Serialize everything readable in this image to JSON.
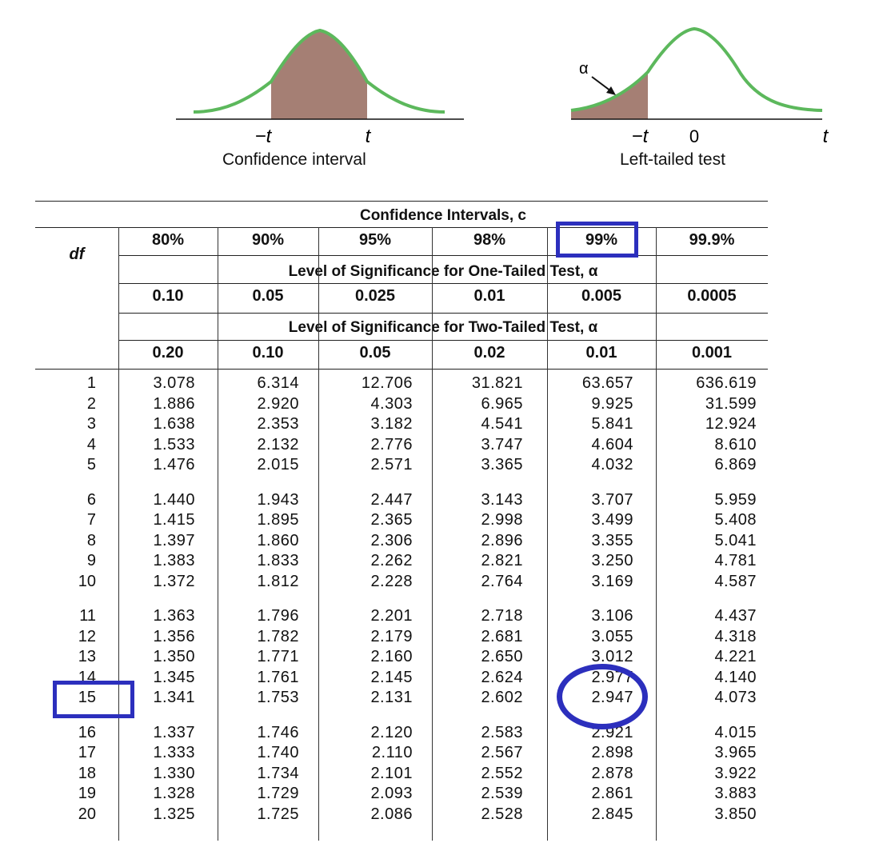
{
  "figures": {
    "confidence": {
      "neg_t": "−t",
      "t": "t",
      "caption": "Confidence interval"
    },
    "left_tailed": {
      "alpha": "α",
      "neg_t": "−t",
      "zero": "0",
      "t": "t",
      "caption": "Left-tailed test"
    }
  },
  "colors": {
    "curve": "#5cb85c",
    "shade": "#a57f74",
    "highlight": "#2c2fbd"
  },
  "table": {
    "confidence_header": "Confidence Intervals, c",
    "confidence_levels": [
      "80%",
      "90%",
      "95%",
      "98%",
      "99%",
      "99.9%"
    ],
    "one_tailed_header": "Level of Significance for One-Tailed Test, α",
    "one_tailed_alphas": [
      "0.10",
      "0.05",
      "0.025",
      "0.01",
      "0.005",
      "0.0005"
    ],
    "two_tailed_header": "Level of Significance for Two-Tailed Test, α",
    "two_tailed_alphas": [
      "0.20",
      "0.10",
      "0.05",
      "0.02",
      "0.01",
      "0.001"
    ],
    "df_label": "df",
    "rows": [
      {
        "df": "1",
        "values": [
          "3.078",
          "6.314",
          "12.706",
          "31.821",
          "63.657",
          "636.619"
        ]
      },
      {
        "df": "2",
        "values": [
          "1.886",
          "2.920",
          "4.303",
          "6.965",
          "9.925",
          "31.599"
        ]
      },
      {
        "df": "3",
        "values": [
          "1.638",
          "2.353",
          "3.182",
          "4.541",
          "5.841",
          "12.924"
        ]
      },
      {
        "df": "4",
        "values": [
          "1.533",
          "2.132",
          "2.776",
          "3.747",
          "4.604",
          "8.610"
        ]
      },
      {
        "df": "5",
        "values": [
          "1.476",
          "2.015",
          "2.571",
          "3.365",
          "4.032",
          "6.869"
        ]
      },
      {
        "df": "6",
        "values": [
          "1.440",
          "1.943",
          "2.447",
          "3.143",
          "3.707",
          "5.959"
        ]
      },
      {
        "df": "7",
        "values": [
          "1.415",
          "1.895",
          "2.365",
          "2.998",
          "3.499",
          "5.408"
        ]
      },
      {
        "df": "8",
        "values": [
          "1.397",
          "1.860",
          "2.306",
          "2.896",
          "3.355",
          "5.041"
        ]
      },
      {
        "df": "9",
        "values": [
          "1.383",
          "1.833",
          "2.262",
          "2.821",
          "3.250",
          "4.781"
        ]
      },
      {
        "df": "10",
        "values": [
          "1.372",
          "1.812",
          "2.228",
          "2.764",
          "3.169",
          "4.587"
        ]
      },
      {
        "df": "11",
        "values": [
          "1.363",
          "1.796",
          "2.201",
          "2.718",
          "3.106",
          "4.437"
        ]
      },
      {
        "df": "12",
        "values": [
          "1.356",
          "1.782",
          "2.179",
          "2.681",
          "3.055",
          "4.318"
        ]
      },
      {
        "df": "13",
        "values": [
          "1.350",
          "1.771",
          "2.160",
          "2.650",
          "3.012",
          "4.221"
        ]
      },
      {
        "df": "14",
        "values": [
          "1.345",
          "1.761",
          "2.145",
          "2.624",
          "2.977",
          "4.140"
        ]
      },
      {
        "df": "15",
        "values": [
          "1.341",
          "1.753",
          "2.131",
          "2.602",
          "2.947",
          "4.073"
        ]
      },
      {
        "df": "16",
        "values": [
          "1.337",
          "1.746",
          "2.120",
          "2.583",
          "2.921",
          "4.015"
        ]
      },
      {
        "df": "17",
        "values": [
          "1.333",
          "1.740",
          "2.110",
          "2.567",
          "2.898",
          "3.965"
        ]
      },
      {
        "df": "18",
        "values": [
          "1.330",
          "1.734",
          "2.101",
          "2.552",
          "2.878",
          "3.922"
        ]
      },
      {
        "df": "19",
        "values": [
          "1.328",
          "1.729",
          "2.093",
          "2.539",
          "2.861",
          "3.883"
        ]
      },
      {
        "df": "20",
        "values": [
          "1.325",
          "1.725",
          "2.086",
          "2.528",
          "2.845",
          "3.850"
        ]
      }
    ]
  },
  "highlights": {
    "column": "99%",
    "df_row": "15",
    "value": "2.947"
  }
}
